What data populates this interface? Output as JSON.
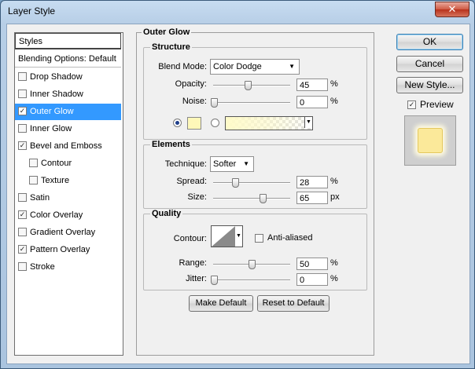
{
  "window": {
    "title": "Layer Style",
    "close_glyph": "✕"
  },
  "styles_list": {
    "header": "Styles",
    "blending": "Blending Options: Default",
    "items": [
      {
        "label": "Drop Shadow",
        "checked": false
      },
      {
        "label": "Inner Shadow",
        "checked": false
      },
      {
        "label": "Outer Glow",
        "checked": true,
        "selected": true
      },
      {
        "label": "Inner Glow",
        "checked": false
      },
      {
        "label": "Bevel and Emboss",
        "checked": true
      },
      {
        "label": "Contour",
        "checked": false,
        "indent": true
      },
      {
        "label": "Texture",
        "checked": false,
        "indent": true
      },
      {
        "label": "Satin",
        "checked": false
      },
      {
        "label": "Color Overlay",
        "checked": true
      },
      {
        "label": "Gradient Overlay",
        "checked": false
      },
      {
        "label": "Pattern Overlay",
        "checked": true
      },
      {
        "label": "Stroke",
        "checked": false
      }
    ]
  },
  "panel": {
    "title": "Outer Glow",
    "structure": {
      "title": "Structure",
      "blend_mode_label": "Blend Mode:",
      "blend_mode_value": "Color Dodge",
      "opacity_label": "Opacity:",
      "opacity_value": "45",
      "opacity_level": 45,
      "noise_label": "Noise:",
      "noise_value": "0",
      "noise_level": 0,
      "percent": "%",
      "solid_color": "#fef8b9"
    },
    "elements": {
      "title": "Elements",
      "technique_label": "Technique:",
      "technique_value": "Softer",
      "spread_label": "Spread:",
      "spread_value": "28",
      "spread_level": 28,
      "size_label": "Size:",
      "size_value": "65",
      "size_level": 65,
      "percent": "%",
      "px": "px"
    },
    "quality": {
      "title": "Quality",
      "contour_label": "Contour:",
      "anti_aliased_label": "Anti-aliased",
      "anti_aliased": false,
      "range_label": "Range:",
      "range_value": "50",
      "range_level": 50,
      "jitter_label": "Jitter:",
      "jitter_value": "0",
      "jitter_level": 0,
      "percent": "%"
    },
    "make_default": "Make Default",
    "reset_default": "Reset to Default"
  },
  "side": {
    "ok": "OK",
    "cancel": "Cancel",
    "new_style": "New Style...",
    "preview_label": "Preview",
    "preview_checked": true
  },
  "check_glyph": "✓",
  "arrow_glyph": "▼"
}
